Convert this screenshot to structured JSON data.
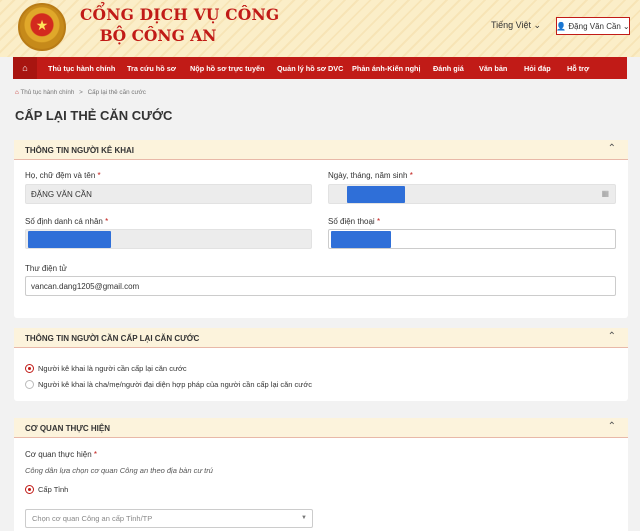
{
  "header": {
    "title_line1": "CỔNG DỊCH VỤ CÔNG",
    "title_line2": "BỘ CÔNG AN",
    "language": "Tiếng Việt",
    "user": "Đặng Văn Cần"
  },
  "nav": {
    "home_icon": "home-icon",
    "items": [
      "Thủ tục hành chính",
      "Tra cứu hồ sơ",
      "Nộp hồ sơ trực tuyến",
      "Quản lý hồ sơ DVC",
      "Phản ánh-Kiến nghị",
      "Đánh giá",
      "Văn bản",
      "Hỏi đáp",
      "Hỗ trợ"
    ]
  },
  "breadcrumb": {
    "home": "Thủ tục hành chính",
    "separator": ">",
    "current": "Cấp lại thẻ căn cước"
  },
  "page_title": "CẤP LẠI THẺ CĂN CƯỚC",
  "declarant": {
    "heading": "THÔNG TIN NGƯỜI KÊ KHAI",
    "name_label": "Họ, chữ đệm và tên",
    "name_value": "ĐẶNG VĂN CẦN",
    "dob_label": "Ngày, tháng, năm sinh",
    "id_label": "Số định danh cá nhân",
    "phone_label": "Số điện thoại",
    "email_label": "Thư điện tử",
    "email_value": "vancan.dang1205@gmail.com",
    "required_mark": "*"
  },
  "applicant": {
    "heading": "THÔNG TIN NGƯỜI CẦN CẤP LẠI CĂN CƯỚC",
    "option1": "Người kê khai là người cần cấp lại căn cước",
    "option2": "Người kê khai là cha/mẹ/người đại diện hợp pháp của người cần cấp lại căn cước"
  },
  "agency": {
    "heading": "CƠ QUAN THỰC HIỆN",
    "label": "Cơ quan thực hiện",
    "note": "Công dân lựa chọn cơ quan Công an theo địa bàn cư trú",
    "level_option": "Cấp Tỉnh",
    "select_placeholder": "Chọn cơ quan Công an cấp Tỉnh/TP"
  },
  "colors": {
    "brand_red": "#c11b17",
    "header_bg": "#fbeec8",
    "redaction_blue": "#2f6fd8"
  }
}
